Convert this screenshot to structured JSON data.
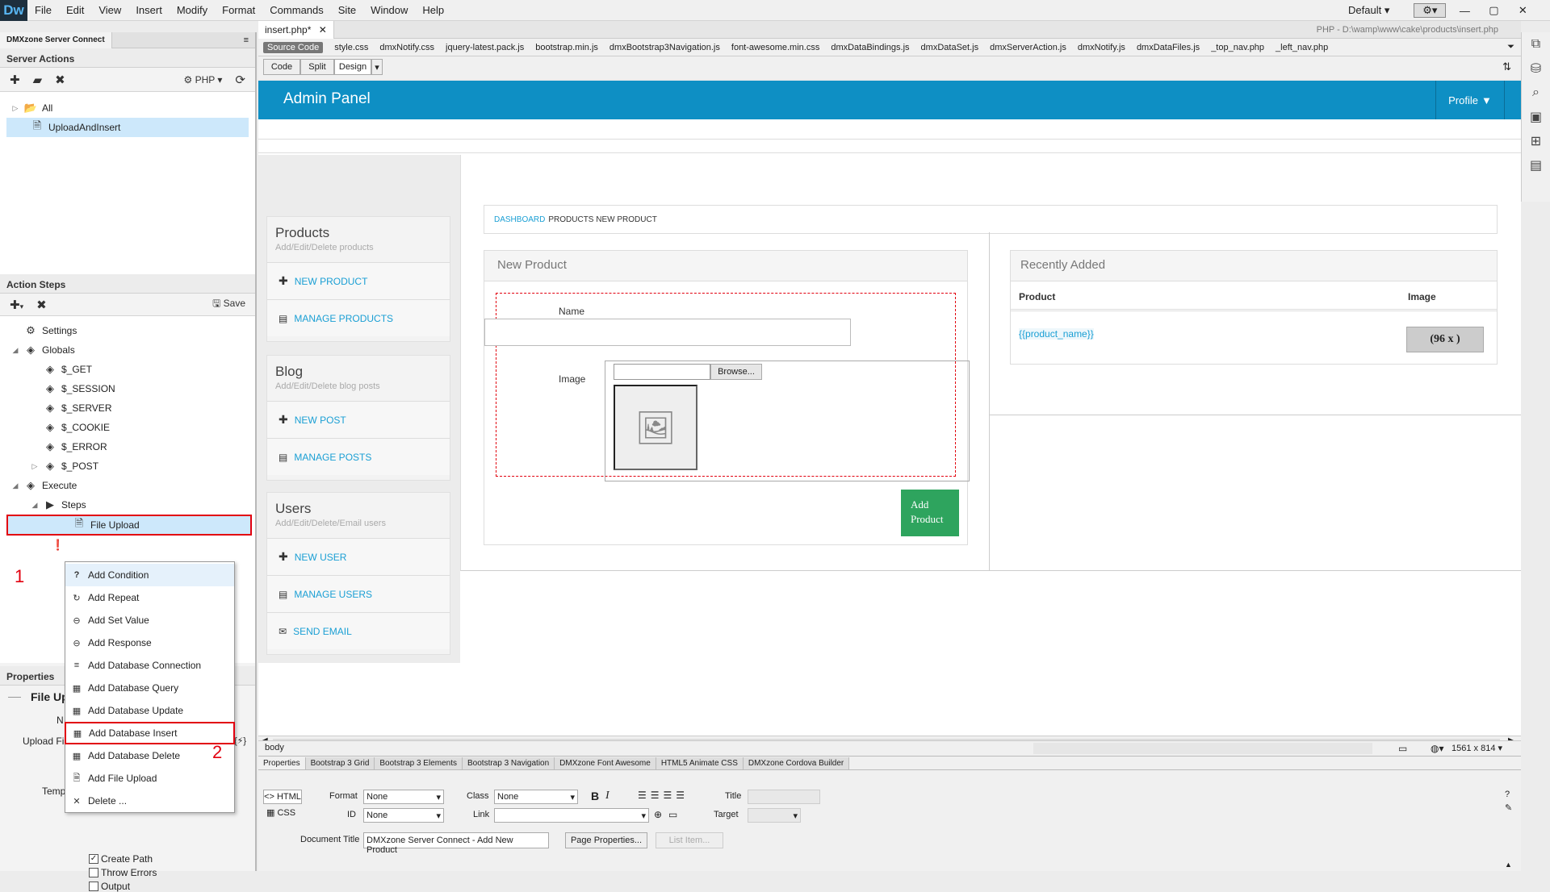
{
  "app": {
    "logo": "Dw",
    "menus": [
      "File",
      "Edit",
      "View",
      "Insert",
      "Modify",
      "Format",
      "Commands",
      "Site",
      "Window",
      "Help"
    ],
    "workspace": "Default"
  },
  "server_connect": {
    "panel_tab": "DMXzone Server Connect",
    "server_actions_title": "Server Actions",
    "php_label": "PHP",
    "tree": [
      "All",
      "UploadAndInsert"
    ]
  },
  "action_steps": {
    "title": "Action Steps",
    "save_label": "Save",
    "items": [
      {
        "label": "Settings",
        "indent": 1
      },
      {
        "label": "Globals",
        "indent": 1
      },
      {
        "label": "$_GET",
        "indent": 2
      },
      {
        "label": "$_SESSION",
        "indent": 2
      },
      {
        "label": "$_SERVER",
        "indent": 2
      },
      {
        "label": "$_COOKIE",
        "indent": 2
      },
      {
        "label": "$_ERROR",
        "indent": 2
      },
      {
        "label": "$_POST",
        "indent": 2
      },
      {
        "label": "Execute",
        "indent": 1
      },
      {
        "label": "Steps",
        "indent": 2
      },
      {
        "label": "File Upload",
        "indent": 3
      }
    ],
    "annotation_1": "1",
    "annotation_2": "2"
  },
  "context_menu": [
    "Add Condition",
    "Add Repeat",
    "Add Set Value",
    "Add Response",
    "Add Database Connection",
    "Add Database Query",
    "Add Database Update",
    "Add Database Insert",
    "Add Database Delete",
    "Add File Upload",
    "Delete ..."
  ],
  "properties_panel": {
    "title": "Properties",
    "subtitle": "File Up",
    "name_label": "N",
    "upload_label": "Upload Fi",
    "temp_label": "Temp",
    "checkboxes": [
      "Create Path",
      "Throw Errors",
      "Output"
    ]
  },
  "document": {
    "tab_name": "insert.php*",
    "path": "PHP - D:\\wamp\\www\\cake\\products\\insert.php",
    "related_files": [
      "Source Code",
      "style.css",
      "dmxNotify.css",
      "jquery-latest.pack.js",
      "bootstrap.min.js",
      "dmxBootstrap3Navigation.js",
      "font-awesome.min.css",
      "dmxDataBindings.js",
      "dmxDataSet.js",
      "dmxServerAction.js",
      "dmxNotify.js",
      "dmxDataFiles.js",
      "_top_nav.php",
      "_left_nav.php"
    ],
    "view_buttons": [
      "Code",
      "Split",
      "Design"
    ]
  },
  "site": {
    "brand": "Admin Panel",
    "profile": "Profile",
    "breadcrumb_link": "DASHBOARD",
    "breadcrumb_rest": "PRODUCTS NEW PRODUCT",
    "groups": [
      {
        "title": "Products",
        "subtitle": "Add/Edit/Delete products",
        "links": [
          "NEW PRODUCT",
          "MANAGE PRODUCTS"
        ]
      },
      {
        "title": "Blog",
        "subtitle": "Add/Edit/Delete blog posts",
        "links": [
          "NEW POST",
          "MANAGE POSTS"
        ]
      },
      {
        "title": "Users",
        "subtitle": "Add/Edit/Delete/Email users",
        "links": [
          "NEW USER",
          "MANAGE USERS",
          "SEND EMAIL"
        ]
      }
    ],
    "new_product_title": "New Product",
    "name_label": "Name",
    "image_label": "Image",
    "browse_label": "Browse...",
    "add_product_label": "Add Product",
    "recently_added_title": "Recently Added",
    "col_product": "Product",
    "col_image": "Image",
    "binding": "{{product_name}}",
    "img_placeholder": "(96 x )"
  },
  "status_bar": {
    "tag": "body",
    "size": "1561 x 814"
  },
  "bottom_tabs": [
    "Properties",
    "Bootstrap 3 Grid",
    "Bootstrap 3 Elements",
    "Bootstrap 3 Navigation",
    "DMXzone Font Awesome",
    "HTML5 Animate CSS",
    "DMXzone Cordova Builder"
  ],
  "html_properties": {
    "html_btn": "HTML",
    "css_btn": "CSS",
    "format_label": "Format",
    "format_value": "None",
    "class_label": "Class",
    "class_value": "None",
    "id_label": "ID",
    "id_value": "None",
    "link_label": "Link",
    "title_label": "Title",
    "target_label": "Target",
    "doc_title_label": "Document Title",
    "doc_title_value": "DMXzone Server Connect - Add New Product",
    "page_props_btn": "Page Properties...",
    "list_item_btn": "List Item..."
  }
}
